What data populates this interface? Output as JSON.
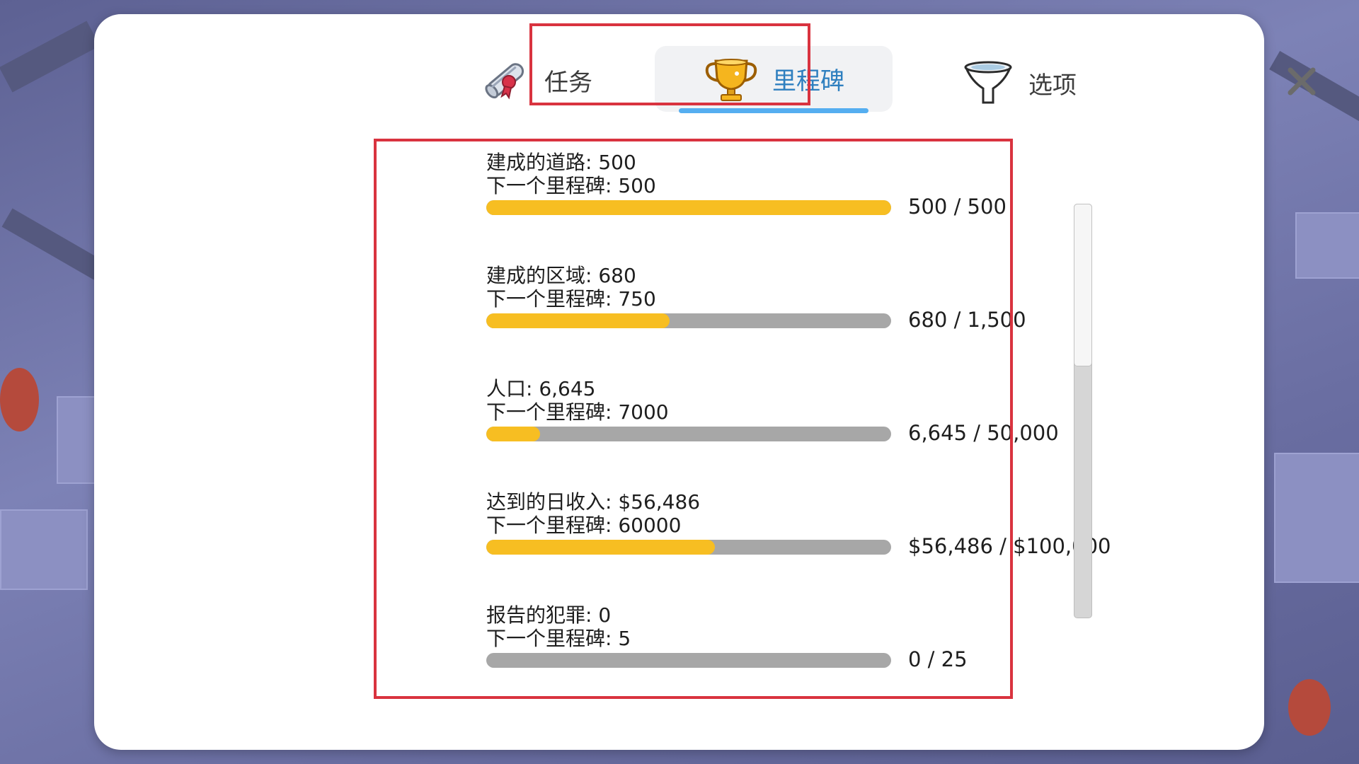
{
  "tabs": {
    "missions": "任务",
    "milestones": "里程碑",
    "options": "选项"
  },
  "active_tab": "milestones",
  "milestones": [
    {
      "label": "建成的道路: 500",
      "next": "下一个里程碑: 500",
      "progress_text": "500 / 500",
      "fraction": 1.0
    },
    {
      "label": "建成的区域: 680",
      "next": "下一个里程碑: 750",
      "progress_text": "680 / 1,500",
      "fraction": 0.453
    },
    {
      "label": "人口: 6,645",
      "next": "下一个里程碑: 7000",
      "progress_text": "6,645 / 50,000",
      "fraction": 0.133
    },
    {
      "label": "达到的日收入: $56,486",
      "next": "下一个里程碑: 60000",
      "progress_text": "$56,486 / $100,000",
      "fraction": 0.565
    },
    {
      "label": "报告的犯罪: 0",
      "next": "下一个里程碑: 5",
      "progress_text": "0 / 25",
      "fraction": 0.0
    }
  ],
  "scrollbar": {
    "position": 0.0,
    "visible_fraction": 0.39
  },
  "colors": {
    "accent": "#2e7fbf",
    "tab_underline": "#55aef0",
    "progress_fill": "#f7be22",
    "progress_track": "#a7a7a7",
    "highlight": "#d9333f"
  },
  "icons": {
    "missions": "scroll-icon",
    "milestones": "trophy-icon",
    "options": "funnel-icon",
    "close": "close-icon"
  }
}
